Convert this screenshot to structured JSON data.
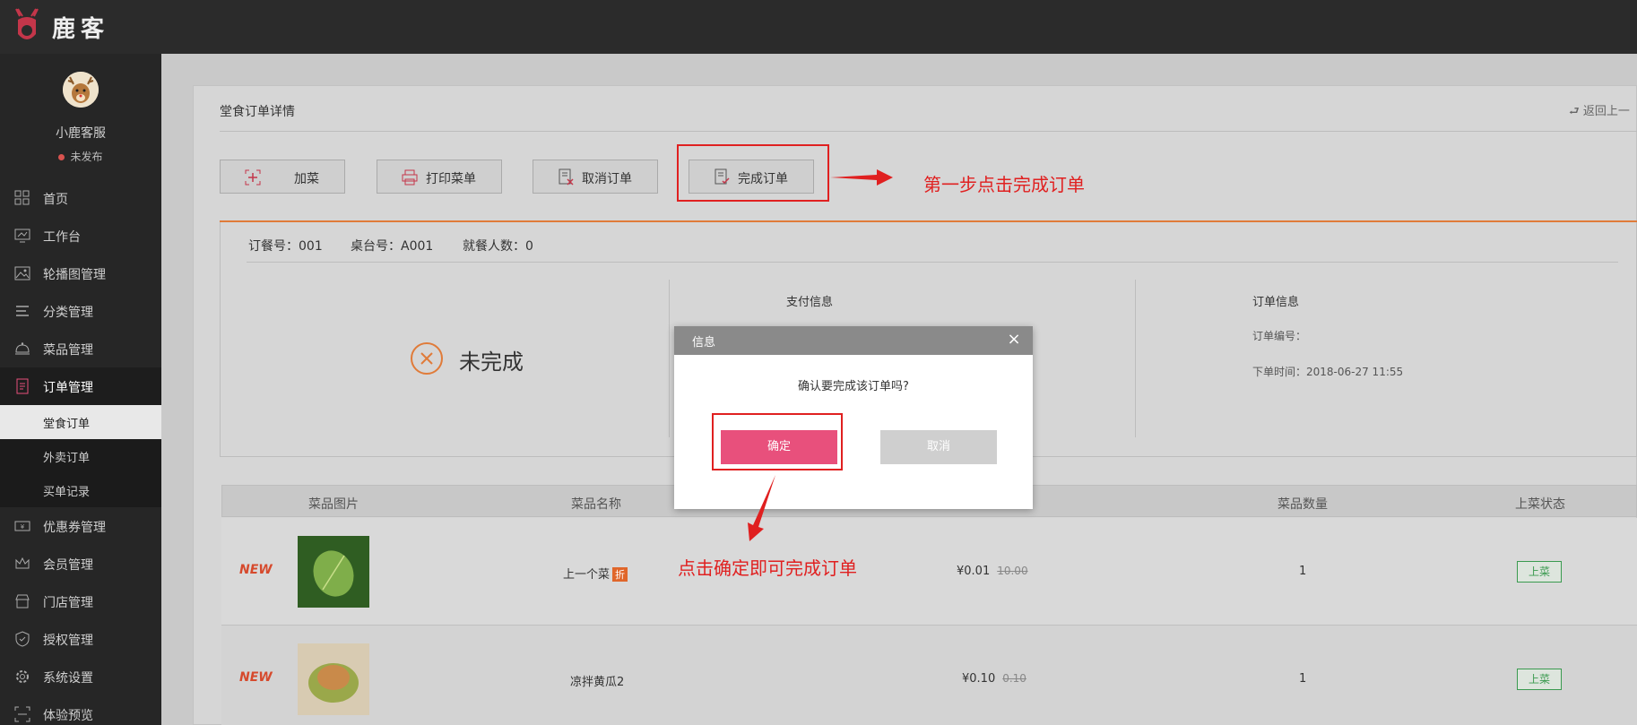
{
  "app": {
    "brand": "鹿客"
  },
  "user": {
    "name": "小鹿客服",
    "status": "未发布"
  },
  "sidebar": {
    "items": [
      {
        "label": "首页",
        "icon": "grid-icon"
      },
      {
        "label": "工作台",
        "icon": "monitor-icon"
      },
      {
        "label": "轮播图管理",
        "icon": "image-icon"
      },
      {
        "label": "分类管理",
        "icon": "list-icon"
      },
      {
        "label": "菜品管理",
        "icon": "dish-cover-icon"
      },
      {
        "label": "订单管理",
        "icon": "order-icon",
        "active": true
      },
      {
        "label": "优惠券管理",
        "icon": "coupon-icon"
      },
      {
        "label": "会员管理",
        "icon": "crown-icon"
      },
      {
        "label": "门店管理",
        "icon": "store-icon"
      },
      {
        "label": "授权管理",
        "icon": "shield-icon"
      },
      {
        "label": "系统设置",
        "icon": "gear-icon"
      },
      {
        "label": "体验预览",
        "icon": "preview-icon"
      }
    ],
    "order_sub_items": [
      {
        "label": "堂食订单",
        "selected": true
      },
      {
        "label": "外卖订单"
      },
      {
        "label": "买单记录"
      }
    ]
  },
  "page": {
    "title": "堂食订单详情",
    "back": "返回上一"
  },
  "actions": [
    {
      "label": "加菜",
      "icon": "add-dish-icon"
    },
    {
      "label": "打印菜单",
      "icon": "printer-icon"
    },
    {
      "label": "取消订单",
      "icon": "cancel-order-icon"
    },
    {
      "label": "完成订单",
      "icon": "complete-order-icon"
    }
  ],
  "order": {
    "order_no": "订餐号：001",
    "table_no": "桌台号：A001",
    "diners": "就餐人数：0",
    "status": "未完成",
    "payment_title": "支付信息",
    "order_info_title": "订单信息",
    "order_code": "订单编号：",
    "order_time": "下单时间：2018-06-27 11:55"
  },
  "table": {
    "headers": [
      "菜品图片",
      "菜品名称",
      "菜品数量",
      "上菜状态"
    ],
    "rows": [
      {
        "tag": "NEW",
        "name": "上一个菜",
        "badge": "折",
        "price": "¥0.01",
        "old_price": "10.00",
        "qty": "1",
        "action": "上菜"
      },
      {
        "tag": "NEW",
        "name": "凉拌黄瓜2",
        "price": "¥0.10",
        "old_price": "0.10",
        "qty": "1",
        "action": "上菜"
      }
    ]
  },
  "dialog": {
    "title": "信息",
    "message": "确认要完成该订单吗?",
    "confirm": "确定",
    "cancel": "取消"
  },
  "annotations": {
    "step1": "第一步点击完成订单",
    "step2": "点击确定即可完成订单",
    "color": "#e02020"
  },
  "colors": {
    "accent": "#e8507c",
    "orange": "#e07b39",
    "sidebar": "#262626"
  }
}
